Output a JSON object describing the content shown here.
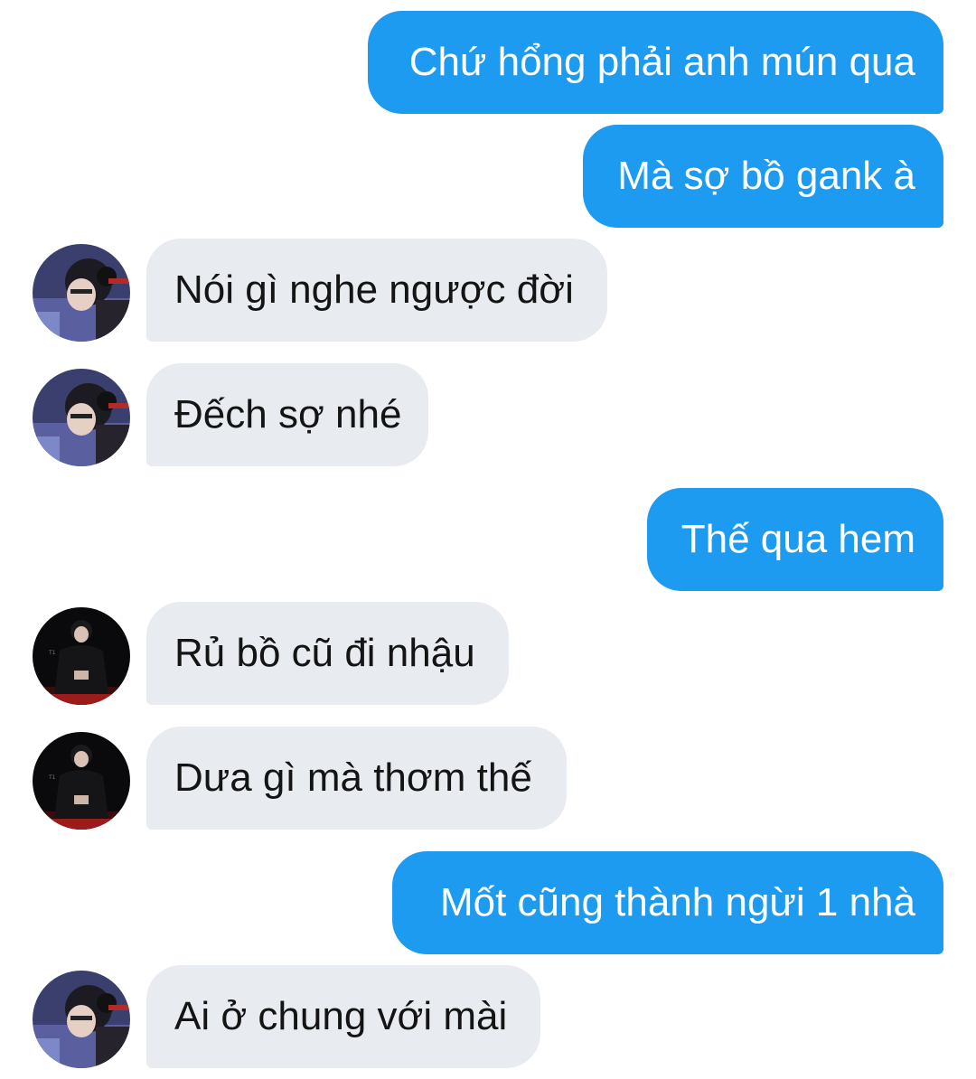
{
  "colors": {
    "sent_bubble": "#1d9bf0",
    "received_bubble": "#e8ecf0",
    "sent_text": "#ffffff",
    "received_text": "#141414"
  },
  "messages": [
    {
      "direction": "sent",
      "text": "Chứ hổng phải anh mún qua"
    },
    {
      "direction": "sent",
      "text": "Mà sợ bồ gank à"
    },
    {
      "direction": "received",
      "avatar": "avatar-player-headset",
      "text": "Nói gì nghe ngược đời"
    },
    {
      "direction": "received",
      "avatar": "avatar-player-headset",
      "text": "Đếch sợ nhé"
    },
    {
      "direction": "sent",
      "text": "Thế qua hem"
    },
    {
      "direction": "received",
      "avatar": "avatar-player-black-jacket",
      "text": "Rủ bồ cũ đi nhậu"
    },
    {
      "direction": "received",
      "avatar": "avatar-player-black-jacket",
      "text": "Dưa gì mà thơm thế"
    },
    {
      "direction": "sent",
      "text": "Mốt cũng thành ngừi 1 nhà"
    },
    {
      "direction": "received",
      "avatar": "avatar-player-headset",
      "text": "Ai ở chung với mài"
    }
  ]
}
